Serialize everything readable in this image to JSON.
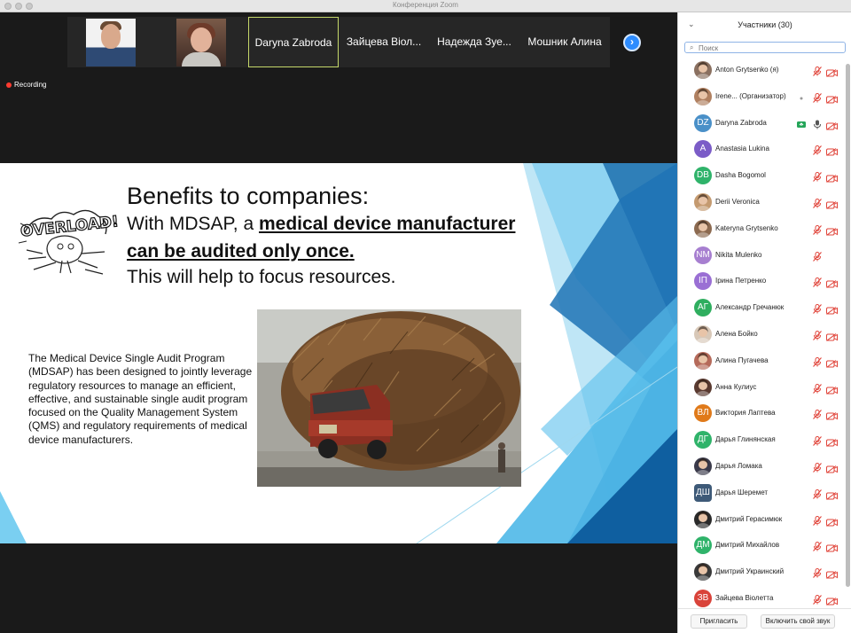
{
  "window": {
    "title": "Конференция Zoom"
  },
  "video": {
    "thumbnails": [
      {
        "label": "",
        "type": "photo-man"
      },
      {
        "label": "",
        "type": "photo-woman"
      },
      {
        "label": "Daryna Zabroda",
        "type": "name",
        "active": true
      },
      {
        "label": "Зайцева Віол...",
        "type": "name"
      },
      {
        "label": "Надежда Зуе...",
        "type": "name"
      },
      {
        "label": "Мошник Алина",
        "type": "name"
      }
    ],
    "next_icon": "chevron-right-icon",
    "recording_label": "Recording",
    "recording_color": "#ff3b30"
  },
  "slide": {
    "logo_text": "OVERLOAD!",
    "heading": "Benefits to companies:",
    "line1_pre": "With MDSAP, a ",
    "line1_bold": "medical device manufacturer",
    "line2": "can be audited only once",
    "line2_tail": ".",
    "line3": "This will help to focus resources.",
    "paragraph": "The Medical Device Single Audit Program (MDSAP) has been designed to jointly leverage regulatory resources to manage an efficient, effective, and sustainable single audit program focused on the Quality Management System (QMS) and regulatory requirements of medical device manufacturers.",
    "photo_subject": "overloaded-truck-photo"
  },
  "panel": {
    "title": "Участники (30)",
    "search_placeholder": "Поиск",
    "participants": [
      {
        "name": "Anton Grytsenko (я)",
        "avatar": "photo",
        "color": "#8a7060",
        "mic": "muted",
        "cam": "off"
      },
      {
        "name": "Irene...     (Организатор)",
        "avatar": "photo",
        "color": "#b08060",
        "mic": "muted",
        "cam": "off",
        "extra": "dot"
      },
      {
        "name": "Daryna Zabroda",
        "initials": "DZ",
        "color": "#4a90c8",
        "mic": "on",
        "cam": "off",
        "extra": "share"
      },
      {
        "name": "Anastasia Lukina",
        "initials": "A",
        "color": "#7b5cc7",
        "mic": "muted",
        "cam": "off"
      },
      {
        "name": "Dasha Bogomol",
        "initials": "DB",
        "color": "#2fb36a",
        "mic": "muted",
        "cam": "off"
      },
      {
        "name": "Derii Veronica",
        "avatar": "photo",
        "color": "#c49a70",
        "mic": "muted",
        "cam": "off"
      },
      {
        "name": "Kateryna Grytsenko",
        "avatar": "photo",
        "color": "#8c6a50",
        "mic": "muted",
        "cam": "off"
      },
      {
        "name": "Nikita Mulenko",
        "initials": "NM",
        "color": "#a77fd0",
        "mic": "muted",
        "cam": "none"
      },
      {
        "name": "Ірина Петренко",
        "initials": "ІП",
        "color": "#9a6fd4",
        "mic": "muted",
        "cam": "off"
      },
      {
        "name": "Александр Гречанюк",
        "initials": "АГ",
        "color": "#2fae5f",
        "mic": "muted",
        "cam": "off"
      },
      {
        "name": "Алена Бойко",
        "avatar": "photo",
        "color": "#d8c8b8",
        "mic": "muted",
        "cam": "off"
      },
      {
        "name": "Алина Пугачева",
        "avatar": "photo",
        "color": "#b56a5a",
        "mic": "muted",
        "cam": "off"
      },
      {
        "name": "Анна Кулиус",
        "avatar": "photo",
        "color": "#5a3a30",
        "mic": "muted",
        "cam": "off"
      },
      {
        "name": "Виктория Лаптева",
        "initials": "ВЛ",
        "color": "#e07a1a",
        "mic": "muted",
        "cam": "off"
      },
      {
        "name": "Дарья Глинянская",
        "initials": "ДГ",
        "color": "#2fb36a",
        "mic": "muted",
        "cam": "off"
      },
      {
        "name": "Дарья Ломака",
        "avatar": "photo",
        "color": "#3a3a4a",
        "mic": "muted",
        "cam": "off"
      },
      {
        "name": "Дарья Шеремет",
        "initials": "ДШ",
        "color": "#3e5a78",
        "mic": "muted",
        "cam": "off",
        "square": true
      },
      {
        "name": "Дмитрий Герасимюк",
        "avatar": "photo",
        "color": "#2a2a2a",
        "mic": "muted",
        "cam": "off"
      },
      {
        "name": "Дмитрий Михайлов",
        "initials": "ДМ",
        "color": "#2fb36a",
        "mic": "muted",
        "cam": "off"
      },
      {
        "name": "Дмитрий Украинский",
        "avatar": "photo",
        "color": "#3a3a3a",
        "mic": "muted",
        "cam": "off"
      },
      {
        "name": "Зайцева Віолетта",
        "initials": "ЗВ",
        "color": "#d9433a",
        "mic": "muted",
        "cam": "off"
      }
    ],
    "invite_label": "Пригласить",
    "unmute_label": "Включить свой звук"
  },
  "colors": {
    "accent": "#2d8cff",
    "muted_icon": "#e0443a",
    "active_border": "#c5d86a",
    "mic_on": "#25a559"
  }
}
